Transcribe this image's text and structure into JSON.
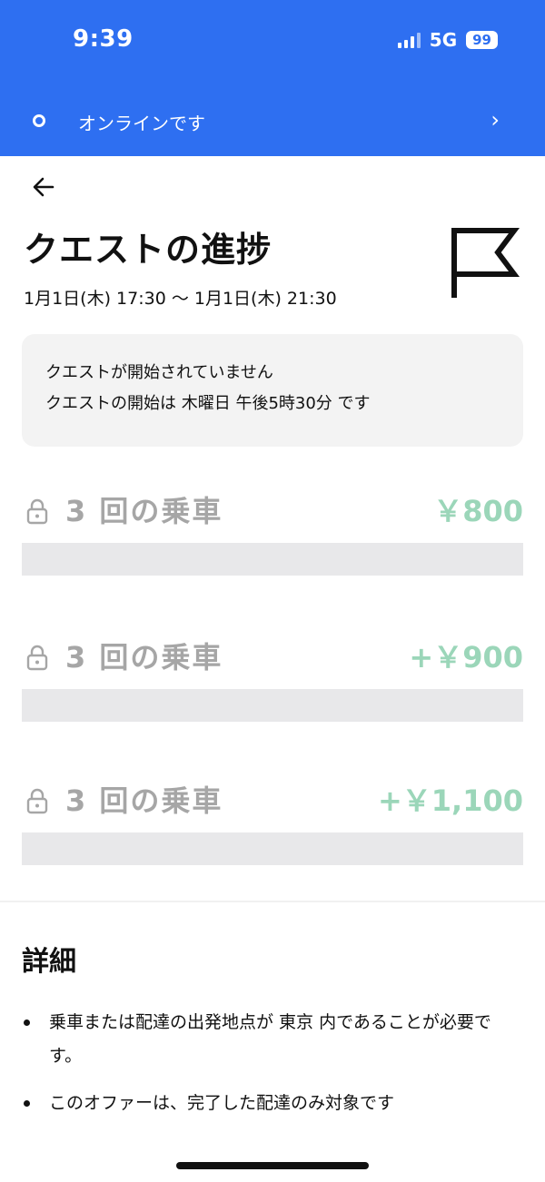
{
  "status_bar": {
    "time": "9:39",
    "network": "5G",
    "battery": "99"
  },
  "online_banner": {
    "label": "オンラインです",
    "chevron": "›"
  },
  "header": {
    "title": "クエストの進捗",
    "date_range": "1月1日(木) 17:30 〜 1月1日(木) 21:30"
  },
  "notice": {
    "line1": "クエストが開始されていません",
    "line2": "クエストの開始は 木曜日 午後5時30分 です"
  },
  "tiers": [
    {
      "label": "3 回の乗車",
      "reward": "￥800"
    },
    {
      "label": "3 回の乗車",
      "reward": "+￥900"
    },
    {
      "label": "3 回の乗車",
      "reward": "+￥1,100"
    }
  ],
  "details": {
    "title": "詳細",
    "items": [
      "乗車または配達の出発地点が 東京 内であることが必要です。",
      "このオファーは、完了した配達のみ対象です"
    ]
  },
  "colors": {
    "header_blue": "#2e6ff1",
    "reward_green": "#9bd6b9",
    "locked_gray": "#a6a6a6"
  },
  "icons": [
    "back-arrow-icon",
    "flag-icon",
    "lock-icon",
    "chevron-right-icon",
    "online-status-icon"
  ]
}
